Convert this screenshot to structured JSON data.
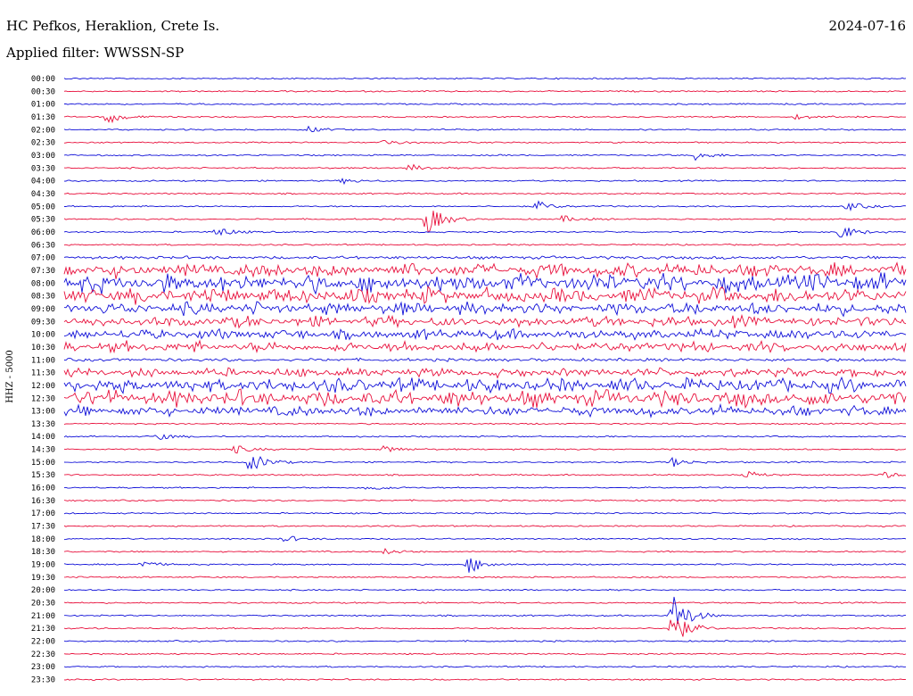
{
  "header": {
    "station": "HC Pefkos, Heraklion, Crete Is.",
    "date": "2024-07-16",
    "filter": "Applied filter: WWSSN-SP",
    "channel_label": "HHZ - 5000"
  },
  "colors": {
    "even_trace": "#1010d8",
    "odd_trace": "#e8103c"
  },
  "chart_data": {
    "type": "line",
    "title": "HC Pefkos, Heraklion, Crete Is.",
    "ylabel": "HHZ - 5000",
    "row_labels": [
      "00:00",
      "00:30",
      "01:00",
      "01:30",
      "02:00",
      "02:30",
      "03:00",
      "03:30",
      "04:00",
      "04:30",
      "05:00",
      "05:30",
      "06:00",
      "06:30",
      "07:00",
      "07:30",
      "08:00",
      "08:30",
      "09:00",
      "09:30",
      "10:00",
      "10:30",
      "11:00",
      "11:30",
      "12:00",
      "12:30",
      "13:00",
      "13:30",
      "14:00",
      "14:30",
      "15:00",
      "15:30",
      "16:00",
      "16:30",
      "17:00",
      "17:30",
      "18:00",
      "18:30",
      "19:00",
      "19:30",
      "20:00",
      "20:30",
      "21:00",
      "21:30",
      "22:00",
      "22:30",
      "23:00",
      "23:30"
    ],
    "noise_amplitude": [
      1,
      1,
      1,
      1,
      1,
      1,
      1,
      1,
      1,
      1,
      1,
      1,
      1,
      1,
      2,
      8,
      10,
      9,
      7,
      6,
      6,
      6,
      2,
      5,
      8,
      9,
      6,
      1,
      1,
      1,
      1,
      1,
      1,
      1,
      1,
      1,
      1,
      1,
      1,
      1,
      1,
      1,
      1,
      1,
      1,
      1,
      1,
      1
    ],
    "events": [
      {
        "row": 3,
        "t": 0.05,
        "amp": 8
      },
      {
        "row": 3,
        "t": 0.87,
        "amp": 3
      },
      {
        "row": 4,
        "t": 0.29,
        "amp": 3
      },
      {
        "row": 5,
        "t": 0.38,
        "amp": 4
      },
      {
        "row": 6,
        "t": 0.75,
        "amp": 5
      },
      {
        "row": 7,
        "t": 0.41,
        "amp": 4
      },
      {
        "row": 8,
        "t": 0.33,
        "amp": 3
      },
      {
        "row": 10,
        "t": 0.56,
        "amp": 6
      },
      {
        "row": 10,
        "t": 0.93,
        "amp": 5
      },
      {
        "row": 11,
        "t": 0.43,
        "amp": 18
      },
      {
        "row": 11,
        "t": 0.59,
        "amp": 4
      },
      {
        "row": 12,
        "t": 0.18,
        "amp": 6
      },
      {
        "row": 12,
        "t": 0.92,
        "amp": 9
      },
      {
        "row": 28,
        "t": 0.11,
        "amp": 4
      },
      {
        "row": 29,
        "t": 0.2,
        "amp": 5
      },
      {
        "row": 29,
        "t": 0.38,
        "amp": 4
      },
      {
        "row": 30,
        "t": 0.22,
        "amp": 12
      },
      {
        "row": 30,
        "t": 0.72,
        "amp": 6
      },
      {
        "row": 31,
        "t": 0.81,
        "amp": 4
      },
      {
        "row": 31,
        "t": 0.97,
        "amp": 4
      },
      {
        "row": 32,
        "t": 0.36,
        "amp": 4
      },
      {
        "row": 36,
        "t": 0.26,
        "amp": 4
      },
      {
        "row": 37,
        "t": 0.38,
        "amp": 3
      },
      {
        "row": 38,
        "t": 0.48,
        "amp": 10
      },
      {
        "row": 38,
        "t": 0.09,
        "amp": 4
      },
      {
        "row": 42,
        "t": 0.72,
        "amp": 30
      },
      {
        "row": 43,
        "t": 0.72,
        "amp": 22
      }
    ]
  }
}
